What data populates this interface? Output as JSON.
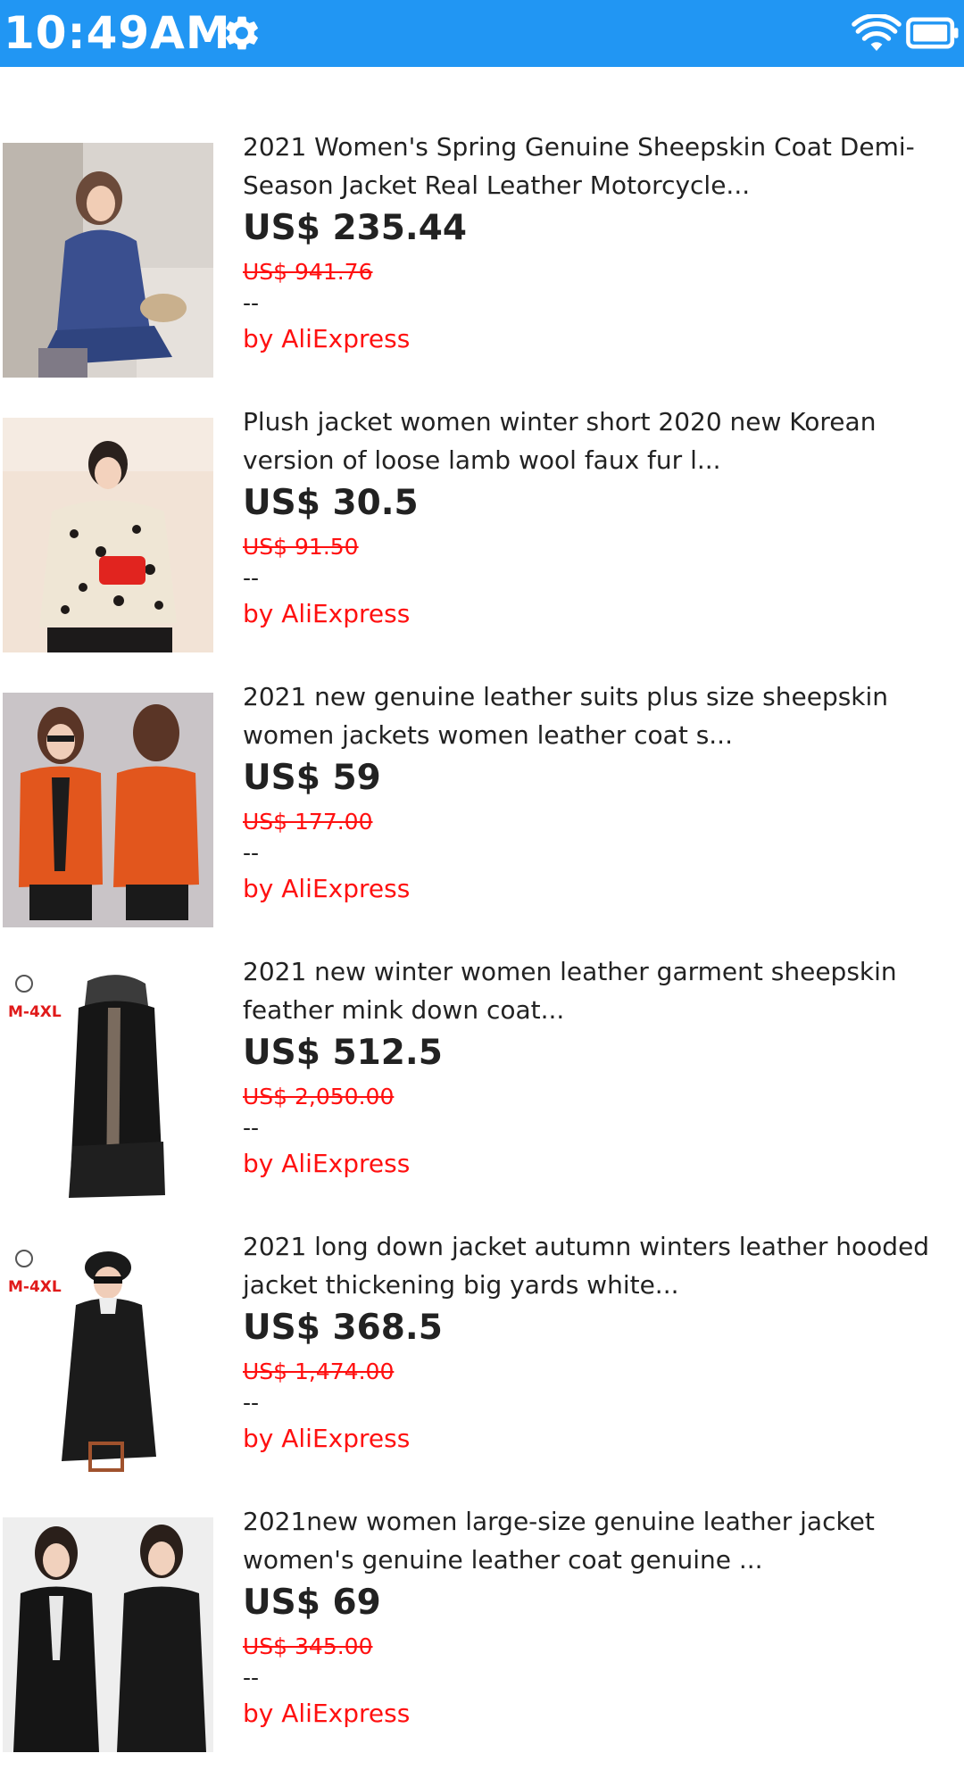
{
  "status_bar": {
    "time": "10:49AM",
    "settings_icon": "gear-icon",
    "wifi_icon": "wifi-icon",
    "battery_icon": "battery-icon",
    "background_color": "#2196f3"
  },
  "products": [
    {
      "title_line1": "2021 Women's Spring Genuine Sheepskin Coat Demi-",
      "title_line2": "Season Jacket Real Leather Motorcycle...",
      "price": "US$ 235.44",
      "original_price": "US$ 941.76",
      "separator": "--",
      "seller": "by AliExpress",
      "image": "woman in blue leather coat"
    },
    {
      "title_line1": "Plush jacket women winter short 2020 new Korean",
      "title_line2": "version of loose lamb wool faux fur l...",
      "price": "US$ 30.5",
      "original_price": "US$ 91.50",
      "separator": "--",
      "seller": "by AliExpress",
      "image": "woman in leopard print plush jacket"
    },
    {
      "title_line1": "2021 new genuine leather suits plus size sheepskin",
      "title_line2": "women jackets women leather coat s...",
      "price": "US$ 59",
      "original_price": "US$ 177.00",
      "separator": "--",
      "seller": "by AliExpress",
      "image": "woman in orange leather blazer"
    },
    {
      "title_line1": "2021 new winter women leather garment sheepskin",
      "title_line2": "feather mink down coat...",
      "price": "US$ 512.5",
      "original_price": "US$ 2,050.00",
      "separator": "--",
      "seller": "by AliExpress",
      "image": "long black hooded leather coat",
      "badge": "M-4XL"
    },
    {
      "title_line1": "2021 long down jacket autumn winters leather hooded",
      "title_line2": "jacket thickening big yards white...",
      "price": "US$ 368.5",
      "original_price": "US$ 1,474.00",
      "separator": "--",
      "seller": "by AliExpress",
      "image": "woman in black hooded down jacket",
      "badge": "M-4XL"
    },
    {
      "title_line1": "2021new women large-size genuine leather jacket",
      "title_line2": "women's genuine leather coat genuine ...",
      "price": "US$ 69",
      "original_price": "US$ 345.00",
      "separator": "--",
      "seller": "by AliExpress",
      "image": "two women in black leather jackets"
    }
  ]
}
